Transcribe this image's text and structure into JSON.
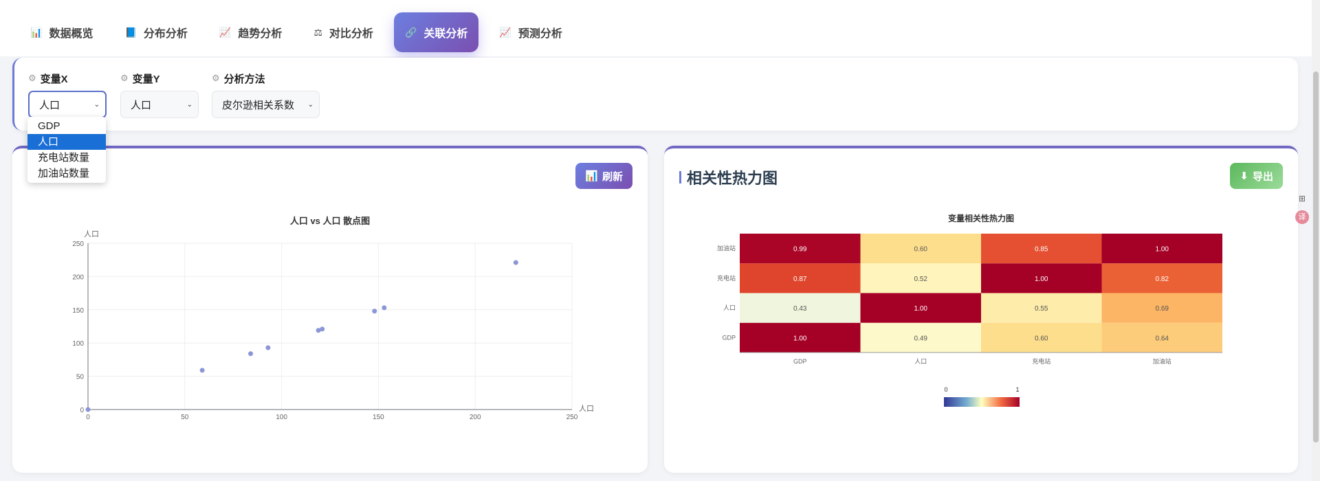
{
  "tabs": [
    {
      "label": "数据概览",
      "icon": "📊"
    },
    {
      "label": "分布分析",
      "icon": "📘"
    },
    {
      "label": "趋势分析",
      "icon": "📈"
    },
    {
      "label": "对比分析",
      "icon": "⚖"
    },
    {
      "label": "关联分析",
      "icon": "🔗"
    },
    {
      "label": "预测分析",
      "icon": "📈"
    }
  ],
  "active_tab": "关联分析",
  "controls": {
    "x": {
      "label": "变量X",
      "value": "人口"
    },
    "y": {
      "label": "变量Y",
      "value": "人口"
    },
    "method": {
      "label": "分析方法",
      "value": "皮尔逊相关系数"
    },
    "dropdown_options": [
      "GDP",
      "人口",
      "充电站数量",
      "加油站数量"
    ],
    "dropdown_selected": "人口"
  },
  "left_card": {
    "refresh_label": "刷新"
  },
  "right_card": {
    "title": "相关性热力图",
    "export_label": "导出"
  },
  "side_tools": {
    "icon1": "⊞",
    "icon2": "译"
  },
  "chart_data": [
    {
      "type": "scatter",
      "title": "人口 vs 人口 散点图",
      "xlabel": "人口",
      "ylabel": "人口",
      "xlim": [
        0,
        250
      ],
      "ylim": [
        0,
        250
      ],
      "xticks": [
        0,
        50,
        100,
        150,
        200,
        250
      ],
      "yticks": [
        0,
        50,
        100,
        150,
        200,
        250
      ],
      "points": [
        [
          0,
          0
        ],
        [
          59,
          59
        ],
        [
          84,
          84
        ],
        [
          93,
          93
        ],
        [
          119,
          119
        ],
        [
          121,
          121
        ],
        [
          148,
          148
        ],
        [
          153,
          153
        ],
        [
          221,
          221
        ]
      ],
      "color": "#8b96d6",
      "grid": true
    },
    {
      "type": "heatmap",
      "title": "变量相关性热力图",
      "x": [
        "GDP",
        "人口",
        "充电站",
        "加油站"
      ],
      "y": [
        "GDP",
        "人口",
        "充电站",
        "加油站"
      ],
      "values": [
        [
          1.0,
          0.49,
          0.6,
          0.64
        ],
        [
          0.43,
          1.0,
          0.55,
          0.69
        ],
        [
          0.87,
          0.52,
          1.0,
          0.82
        ],
        [
          0.99,
          0.6,
          0.85,
          1.0
        ]
      ],
      "value_labels": [
        [
          "1.00",
          "0.49",
          "0.60",
          "0.64"
        ],
        [
          "0.43",
          "1.00",
          "0.55",
          "0.69"
        ],
        [
          "0.87",
          "0.52",
          "1.00",
          "0.82"
        ],
        [
          "0.99",
          "0.60",
          "0.85",
          "1.00"
        ]
      ],
      "visual_map": {
        "min": "0",
        "max": "1"
      }
    }
  ]
}
